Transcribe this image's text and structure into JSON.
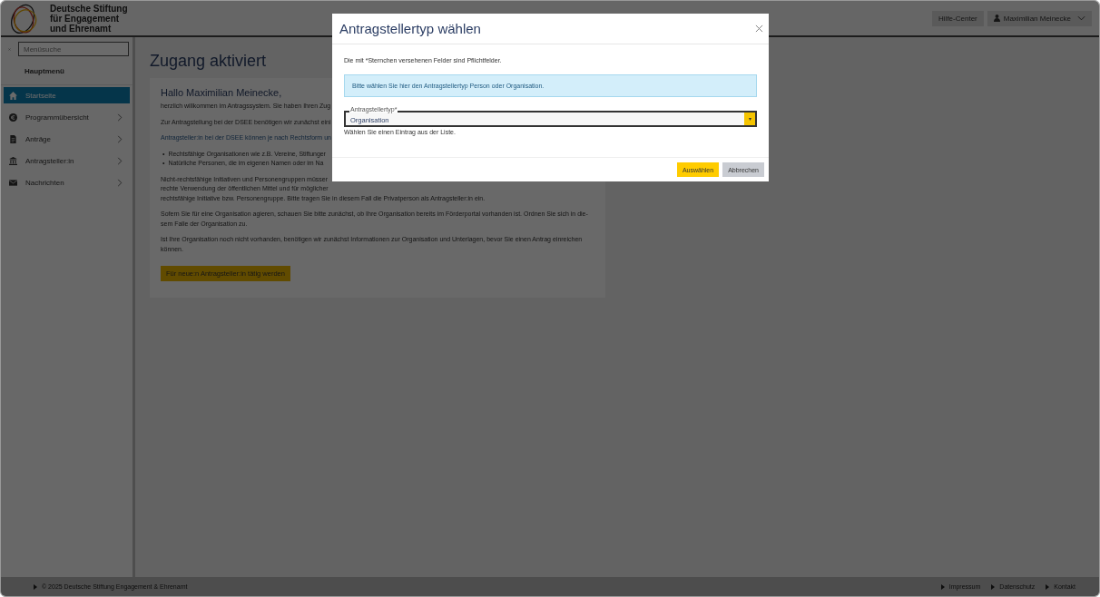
{
  "header": {
    "logo_lines": [
      "Deutsche Stiftung",
      "für Engagement",
      "und Ehrenamt"
    ],
    "help_button": "Hilfe-Center",
    "user_menu": "Maximilian Meinecke"
  },
  "sidebar": {
    "search": {
      "placeholder": "Menüsuche"
    },
    "heading": "Hauptmenü",
    "items": [
      {
        "label": "Startseite",
        "selected": true,
        "expandable": false
      },
      {
        "label": "Programmübersicht",
        "selected": false,
        "expandable": true
      },
      {
        "label": "Anträge",
        "selected": false,
        "expandable": true
      },
      {
        "label": "Antragsteller:in",
        "selected": false,
        "expandable": true
      },
      {
        "label": "Nachrichten",
        "selected": false,
        "expandable": true
      }
    ]
  },
  "page": {
    "title": "Zugang aktiviert",
    "greeting": "Hallo Maximilian Meinecke,",
    "blocks": [
      {
        "kind": "text",
        "lines": [
          "herzlich willkommen im Antragssystem. Sie haben Ihren Zug"
        ]
      },
      {
        "kind": "text",
        "lines": [
          "Zur Antragstellung bei der DSEE benötigen wir zunächst eini"
        ]
      },
      {
        "kind": "note",
        "lines": [
          "Antragsteller:in bei der DSEE können je nach Rechtsform un"
        ]
      },
      {
        "kind": "list",
        "marker": "•",
        "lines": [
          "Rechtsfähige Organisationen wie z.B. Vereine, Stiftunger",
          "Natürliche Personen, die im eigenen Namen oder im Na"
        ]
      },
      {
        "kind": "text",
        "lines": [
          "Nicht-rechtsfähige Initiativen und Personengruppen müsser",
          "rechte Verwendung der öffentlichen Mittel und für möglicher",
          "rechtsfähige Initiative bzw. Personengruppe. Bitte tragen Sie in diesem Fall die Privatperson als Antragsteller:in ein."
        ]
      },
      {
        "kind": "text",
        "lines": [
          "Sofern Sie für eine Organisation agieren, schauen Sie bitte zunächst, ob Ihre Organisation bereits im Förderportal vorhanden ist. Ordnen Sie sich in die-",
          "sem Falle der Organisation zu."
        ]
      },
      {
        "kind": "text",
        "lines": [
          "Ist Ihre Organisation noch nicht vorhanden, benötigen wir zunächst Informationen zur Organisation und Unterlagen, bevor Sie einen Antrag einreichen",
          "können."
        ]
      }
    ],
    "action_button": "Für neue:n Antragsteller:in tätig werden"
  },
  "footer": {
    "copyright": "© 2025 Deutsche Stiftung Engagement & Ehrenamt",
    "links": [
      "Impressum",
      "Datenschutz",
      "Kontakt"
    ]
  },
  "dialog": {
    "title": "Antragstellertyp wählen",
    "required_note": "Die mit *Sternchen versehenen Felder sind Pflichtfelder.",
    "info": "Bitte wählen Sie hier den Antragstellertyp Person oder Organisation.",
    "field": {
      "label": "Antragstellertyp*",
      "value": "Organisation",
      "hint": "Wählen Sie einen Eintrag aus der Liste."
    },
    "buttons": [
      {
        "label": "Auswählen",
        "kind": "primary"
      },
      {
        "label": "Abbrechen",
        "kind": "secondary"
      }
    ]
  }
}
